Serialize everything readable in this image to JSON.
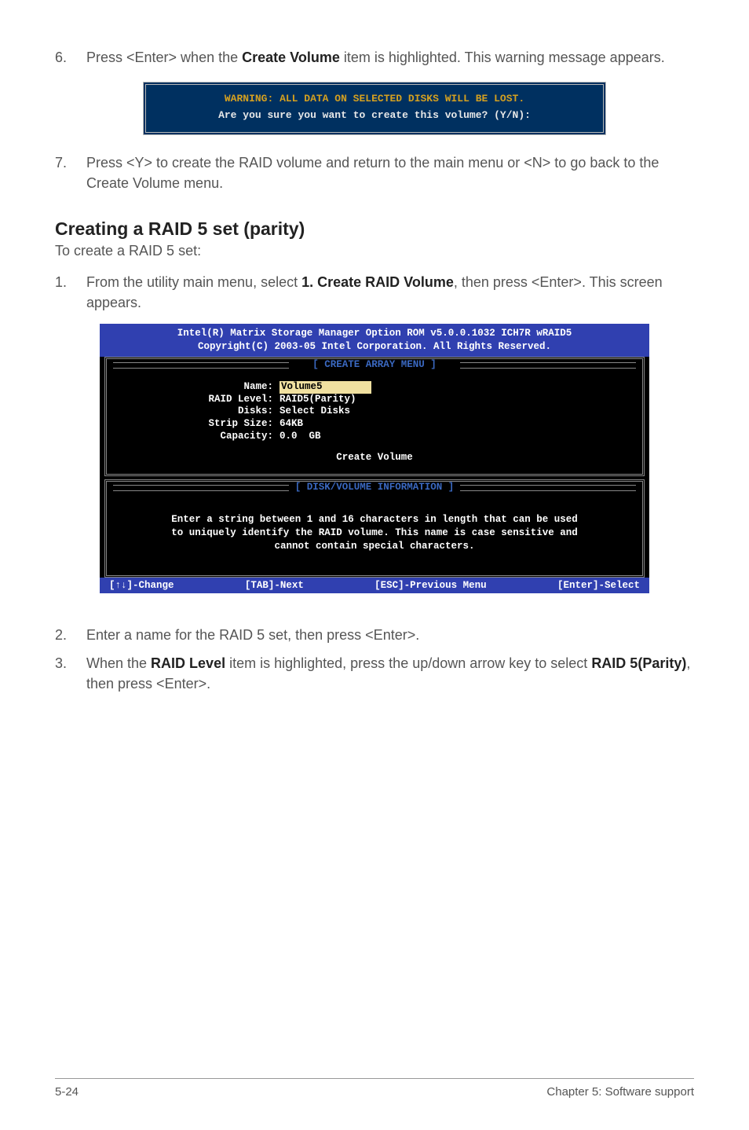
{
  "step6": {
    "num": "6.",
    "text_pre": "Press <Enter> when the ",
    "bold": "Create Volume",
    "text_post": " item is highlighted. This warning message appears."
  },
  "warning_box": {
    "line1": "WARNING: ALL DATA ON SELECTED DISKS WILL BE LOST.",
    "line2": "Are you sure you want to create this volume? (Y/N):"
  },
  "step7": {
    "num": "7.",
    "text": "Press <Y> to create the RAID volume and return to the main menu or <N> to go back to the Create Volume menu."
  },
  "section": {
    "title": "Creating a RAID 5 set (parity)",
    "subtitle": "To create a RAID 5 set:"
  },
  "step1": {
    "num": "1.",
    "text_pre": "From the utility main menu, select ",
    "bold": "1. Create RAID Volume",
    "text_post": ", then press <Enter>. This screen appears."
  },
  "bios": {
    "header1": "Intel(R) Matrix Storage Manager Option ROM v5.0.0.1032 ICH7R wRAID5",
    "header2": "Copyright(C) 2003-05 Intel Corporation. All Rights Reserved.",
    "array_title": "[ CREATE ARRAY MENU ]",
    "fields": {
      "name_label": "Name:",
      "name_value": "Volume5",
      "raid_label": "RAID Level:",
      "raid_value": "RAID5(Parity)",
      "disks_label": "Disks:",
      "disks_value": "Select Disks",
      "strip_label": "Strip Size:",
      "strip_value": "64KB",
      "cap_label": "Capacity:",
      "cap_value": "0.0  GB"
    },
    "action": "Create Volume",
    "disk_title": "[ DISK/VOLUME INFORMATION ]",
    "help1": "Enter a string between 1 and 16 characters in length that can be used",
    "help2": "to uniquely identify the RAID volume. This name is case sensitive and",
    "help3": "cannot contain special characters.",
    "footer": {
      "change": "[↑↓]-Change",
      "next": "[TAB]-Next",
      "prev": "[ESC]-Previous Menu",
      "select": "[Enter]-Select"
    }
  },
  "step2": {
    "num": "2.",
    "text": "Enter a name for the RAID 5 set, then press <Enter>."
  },
  "step3": {
    "num": "3.",
    "pre": "When the ",
    "b1": "RAID Level",
    "mid": " item is highlighted, press the up/down arrow key to select ",
    "b2": "RAID 5(Parity)",
    "post": ", then press <Enter>."
  },
  "footer": {
    "left": "5-24",
    "right": "Chapter 5: Software support"
  }
}
